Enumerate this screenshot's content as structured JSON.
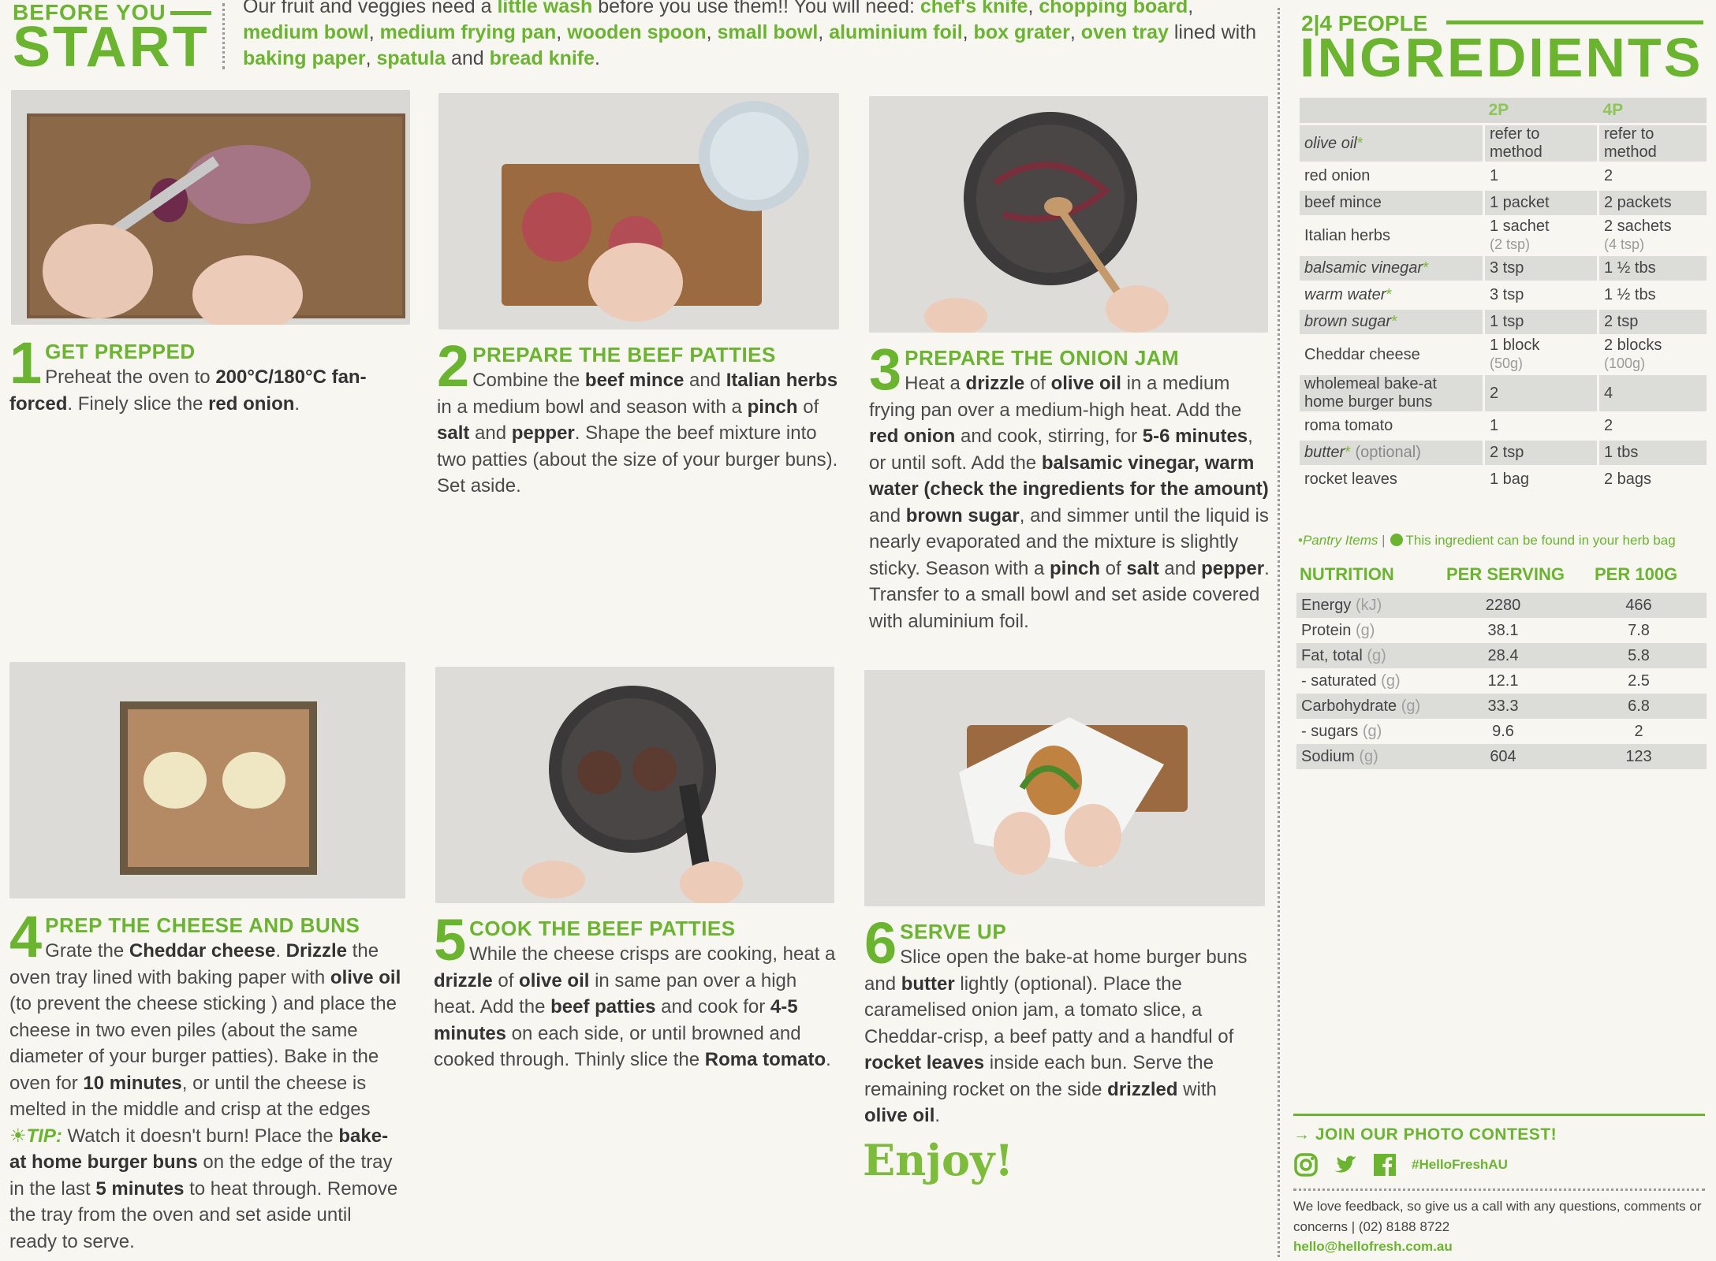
{
  "before_start": {
    "label_small": "BEFORE YOU",
    "label_big": "START",
    "intro_1": "Our fruit and veggies need a ",
    "little_wash": "little wash",
    "intro_2": " before you use them!! You will need: ",
    "tools": [
      "chef's knife",
      "chopping board",
      "medium bowl",
      "medium frying pan",
      "wooden spoon",
      "small bowl",
      "aluminium foil",
      "box grater",
      "oven tray"
    ],
    "lined_with": " lined with ",
    "baking_paper": "baking paper",
    "spatula": "spatula",
    "and": " and ",
    "bread_knife": "bread knife",
    "period": "."
  },
  "steps": [
    {
      "number": "1",
      "title": "GET PREPPED",
      "segments": [
        {
          "t": "Preheat the oven to "
        },
        {
          "b": "200°C/180°C fan-forced"
        },
        {
          "t": ". Finely slice the "
        },
        {
          "b": "red onion"
        },
        {
          "t": "."
        }
      ]
    },
    {
      "number": "2",
      "title": "PREPARE THE BEEF PATTIES",
      "segments": [
        {
          "t": "Combine the "
        },
        {
          "b": "beef mince"
        },
        {
          "t": " and "
        },
        {
          "b": "Italian herbs"
        },
        {
          "t": " in a medium bowl and season with a "
        },
        {
          "b": "pinch"
        },
        {
          "t": " of "
        },
        {
          "b": "salt"
        },
        {
          "t": " and "
        },
        {
          "b": "pepper"
        },
        {
          "t": ". Shape the beef mixture into two patties (about the size of your burger buns). Set aside."
        }
      ]
    },
    {
      "number": "3",
      "title": "PREPARE THE ONION JAM",
      "segments": [
        {
          "t": "Heat a "
        },
        {
          "b": "drizzle"
        },
        {
          "t": " of "
        },
        {
          "b": "olive oil"
        },
        {
          "t": " in a medium frying pan over a medium-high heat. Add the "
        },
        {
          "b": "red onion"
        },
        {
          "t": " and cook, stirring, for "
        },
        {
          "b": "5-6 minutes"
        },
        {
          "t": ", or until soft. Add the "
        },
        {
          "b": "balsamic vinegar, warm water (check the ingredients for the amount)"
        },
        {
          "t": " and "
        },
        {
          "b": "brown sugar"
        },
        {
          "t": ", and simmer until the liquid is nearly evaporated and the mixture is slightly sticky. Season with a "
        },
        {
          "b": "pinch"
        },
        {
          "t": " of "
        },
        {
          "b": "salt"
        },
        {
          "t": " and "
        },
        {
          "b": "pepper"
        },
        {
          "t": ". Transfer to a small bowl and set aside covered with aluminium foil."
        }
      ]
    },
    {
      "number": "4",
      "title": "PREP THE CHEESE AND BUNS",
      "segments": [
        {
          "t": "Grate the "
        },
        {
          "b": "Cheddar cheese"
        },
        {
          "t": ". "
        },
        {
          "b": "Drizzle"
        },
        {
          "t": " the oven tray lined with baking paper with "
        },
        {
          "b": "olive oil"
        },
        {
          "t": " (to prevent the cheese sticking ) and place the cheese in two even piles (about the same diameter of your burger patties). Bake in the oven for "
        },
        {
          "b": "10 minutes"
        },
        {
          "t": ", or until the cheese is melted in the middle and crisp at the edges"
        }
      ],
      "tip_label": "TIP:",
      "tip_segments": [
        {
          "t": " Watch it doesn't burn! Place the "
        },
        {
          "b": "bake-at home burger buns"
        },
        {
          "t": " on the edge of the tray in the last "
        },
        {
          "b": "5 minutes"
        },
        {
          "t": " to heat through. Remove the tray from the oven and set aside until ready to serve."
        }
      ]
    },
    {
      "number": "5",
      "title": "COOK THE BEEF PATTIES",
      "segments": [
        {
          "t": "While the cheese crisps are cooking, heat a "
        },
        {
          "b": "drizzle"
        },
        {
          "t": " of "
        },
        {
          "b": "olive oil"
        },
        {
          "t": " in same pan over a high heat. Add the "
        },
        {
          "b": "beef patties"
        },
        {
          "t": " and cook for "
        },
        {
          "b": "4-5 minutes"
        },
        {
          "t": " on each side, or until browned and cooked through. Thinly slice the "
        },
        {
          "b": "Roma tomato"
        },
        {
          "t": "."
        }
      ]
    },
    {
      "number": "6",
      "title": "SERVE UP",
      "segments": [
        {
          "t": "Slice open the bake-at home burger buns and "
        },
        {
          "b": "butter"
        },
        {
          "t": " lightly (optional). Place the caramelised onion jam, a tomato slice, a Cheddar-crisp, a beef patty and a handful of "
        },
        {
          "b": "rocket leaves"
        },
        {
          "t": " inside each bun. Serve the remaining rocket on the side "
        },
        {
          "b": "drizzled"
        },
        {
          "t": " with "
        },
        {
          "b": "olive oil"
        },
        {
          "t": "."
        }
      ]
    }
  ],
  "enjoy": "Enjoy!",
  "ingredients": {
    "people_label": "2|4 PEOPLE",
    "title": "INGREDIENTS",
    "col_2p": "2P",
    "col_4p": "4P",
    "rows": [
      {
        "name": "olive oil",
        "pantry": true,
        "q2": "refer to method",
        "q4": "refer to method"
      },
      {
        "name": "red onion",
        "q2": "1",
        "q4": "2"
      },
      {
        "name": "beef mince",
        "q2": "1 packet",
        "q4": "2 packets"
      },
      {
        "name": "Italian herbs",
        "q2": "1 sachet",
        "q2_sub": "(2 tsp)",
        "q4": "2 sachets",
        "q4_sub": "(4 tsp)"
      },
      {
        "name": "balsamic vinegar",
        "pantry": true,
        "q2": "3 tsp",
        "q4": "1 ½ tbs"
      },
      {
        "name": "warm water",
        "pantry": true,
        "q2": "3 tsp",
        "q4": "1 ½ tbs"
      },
      {
        "name": "brown sugar",
        "pantry": true,
        "q2": "1 tsp",
        "q4": "2 tsp"
      },
      {
        "name": "Cheddar cheese",
        "q2": "1 block",
        "q2_sub": "(50g)",
        "q4": "2 blocks",
        "q4_sub": "(100g)"
      },
      {
        "name": "wholemeal bake-at home burger buns",
        "q2": "2",
        "q4": "4"
      },
      {
        "name": "roma tomato",
        "q2": "1",
        "q4": "2"
      },
      {
        "name": "butter",
        "pantry": true,
        "optional": "(optional)",
        "q2": "2 tsp",
        "q4": "1 tbs"
      },
      {
        "name": "rocket leaves",
        "q2": "1 bag",
        "q4": "2 bags"
      }
    ],
    "legend_pantry": "Pantry Items",
    "legend_separator": "|",
    "legend_herb": "This ingredient can be found in your herb bag"
  },
  "nutrition": {
    "title": "NUTRITION",
    "col_serving": "PER SERVING",
    "col_100g": "PER 100G",
    "rows": [
      {
        "name": "Energy",
        "unit": "(kJ)",
        "serving": "2280",
        "per100": "466"
      },
      {
        "name": "Protein",
        "unit": "(g)",
        "serving": "38.1",
        "per100": "7.8"
      },
      {
        "name": "Fat, total",
        "unit": "(g)",
        "serving": "28.4",
        "per100": "5.8"
      },
      {
        "name": "- saturated",
        "unit": "(g)",
        "serving": "12.1",
        "per100": "2.5"
      },
      {
        "name": "Carbohydrate",
        "unit": "(g)",
        "serving": "33.3",
        "per100": "6.8"
      },
      {
        "name": "- sugars",
        "unit": "(g)",
        "serving": "9.6",
        "per100": "2"
      },
      {
        "name": "Sodium",
        "unit": "(g)",
        "serving": "604",
        "per100": "123"
      }
    ]
  },
  "footer": {
    "contest": "→ JOIN OUR PHOTO CONTEST!",
    "hashtag": "#HelloFreshAU",
    "feedback": "We love feedback, so give us a call with any questions, comments or concerns | (02) 8188 8722",
    "email": "hello@hellofresh.com.au",
    "icons": [
      "instagram-icon",
      "twitter-icon",
      "facebook-icon"
    ]
  },
  "colors": {
    "brand_green": "#6bb42f",
    "text": "#4a4a4a",
    "row_shade": "#dcdcd9"
  }
}
